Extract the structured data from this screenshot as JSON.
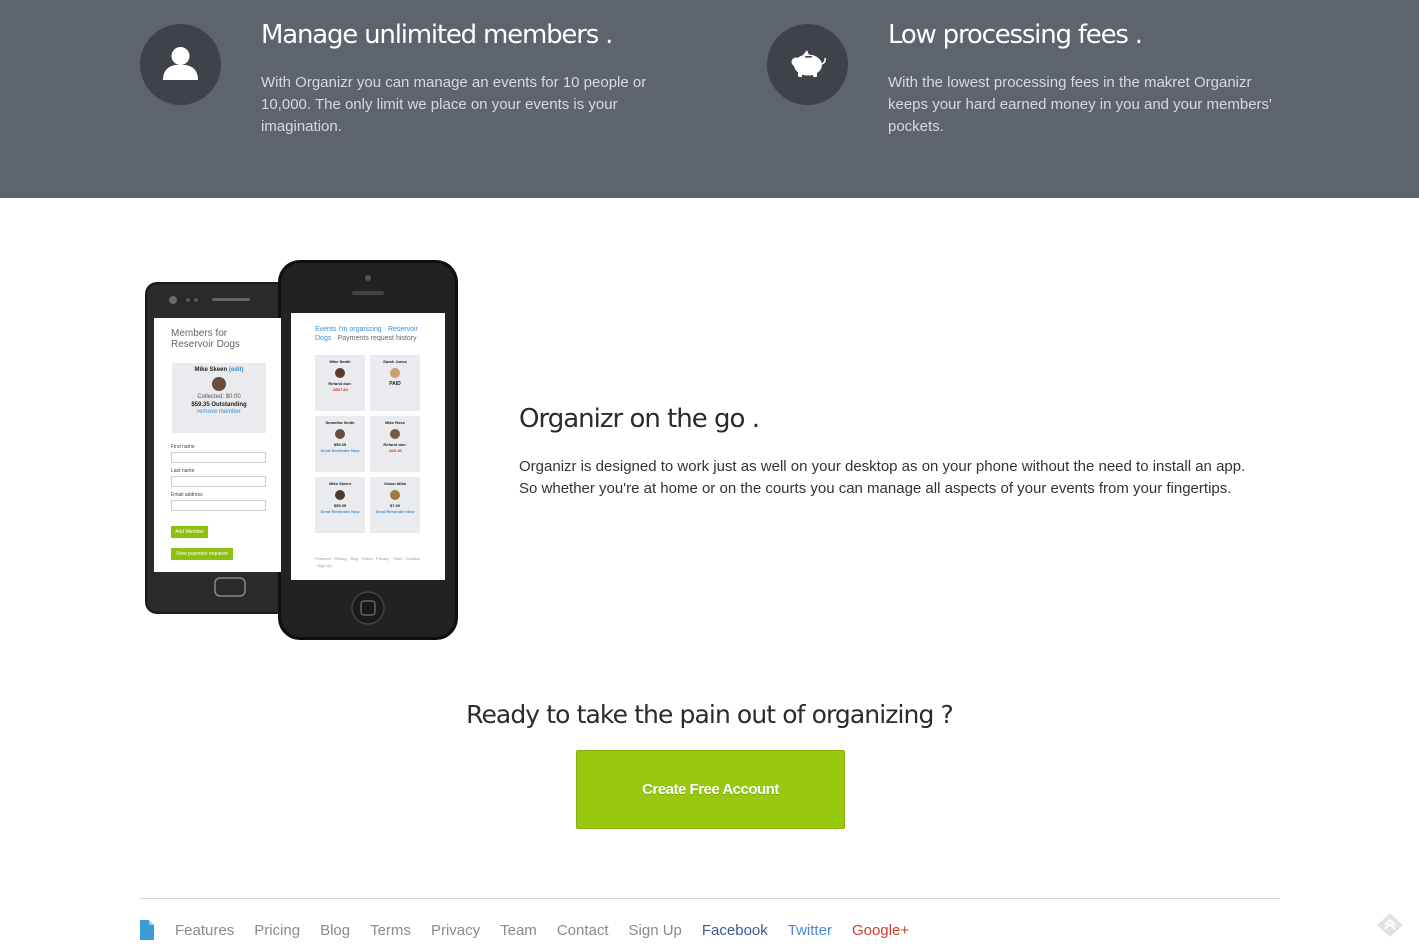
{
  "features": [
    {
      "icon": "user-icon",
      "title": "Manage unlimited members .",
      "text": "With Organizr you can manage an events for 10 people or 10,000. The only limit we place on your events is your imagination."
    },
    {
      "icon": "piggy-bank-icon",
      "title": "Low processing fees .",
      "text": "With the lowest processing fees in the makret Organizr keeps your hard earned money in you and your members' pockets."
    }
  ],
  "mobile": {
    "title": "Organizr on the go .",
    "text": "Organizr is designed to work just as well on your desktop as on your phone without the need to install an app. So whether you're at home or on the courts you can manage all aspects of your events from your fingertips.",
    "android_screen": {
      "heading_line1": "Members for",
      "heading_line2": "Reservoir Dogs",
      "member_name": "Mike Skeen",
      "edit_label": "(edit)",
      "collected": "Collected: $0.00",
      "outstanding": "$59.35 Outstanding",
      "remove_label": "remove member",
      "first_name_label": "First name",
      "last_name_label": "Last name",
      "email_label": "Email address",
      "add_member_label": "Add Member",
      "view_payments_label": "View payment requests"
    },
    "iphone_screen": {
      "breadcrumb_1": "Events I'm organizing",
      "breadcrumb_2": "Reservoir Dogs",
      "breadcrumb_3": "Payments request history",
      "cards": [
        {
          "name": "Mike Smith",
          "line1": "Refund due:",
          "line2": "-$507.84"
        },
        {
          "name": "Sarah Jones",
          "line1": "",
          "line2": "PAID"
        },
        {
          "name": "Smantha Smith",
          "line1": "$59.35",
          "line2": "Send Reminder Now"
        },
        {
          "name": "Mike Ross",
          "line1": "Refund due:",
          "line2": "-$29.36"
        },
        {
          "name": "Mike Skeen",
          "line1": "$59.35",
          "line2": "Send Reminder Now"
        },
        {
          "name": "Odum Idika",
          "line1": "$7.39",
          "line2": "Send Reminder Now"
        }
      ],
      "footer_links": "Features · Pricing · Blog · Terms · Privacy · Team · Contact · Sign Up"
    }
  },
  "cta": {
    "title": "Ready to take the pain out of organizing ?",
    "button_label": "Create Free Account"
  },
  "footer": {
    "links": [
      "Features",
      "Pricing",
      "Blog",
      "Terms",
      "Privacy",
      "Team",
      "Contact",
      "Sign Up"
    ],
    "social": {
      "facebook": "Facebook",
      "twitter": "Twitter",
      "gplus": "Google+"
    },
    "colors": {
      "facebook": "#3b5998",
      "twitter": "#4a8bd6",
      "gplus": "#c8412d"
    }
  },
  "colors": {
    "features_band": "#5e646d",
    "icon_circle": "#3f4349",
    "cta_green": "#97c80e"
  }
}
